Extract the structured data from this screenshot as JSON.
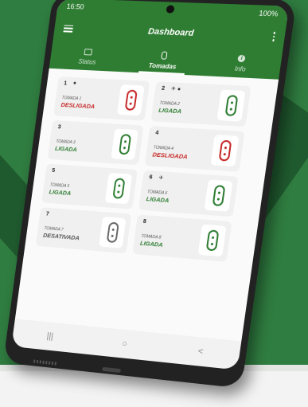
{
  "status_bar": {
    "time": "16:50",
    "battery": "100%"
  },
  "appbar": {
    "title": "Dashboard"
  },
  "tabs": [
    {
      "label": "Status"
    },
    {
      "label": "Tomadas"
    },
    {
      "label": "Info"
    }
  ],
  "info_glyph": "i",
  "cards": [
    {
      "number": "1",
      "extra": "●",
      "name": "TOMADA 1",
      "state": "DESLIGADA",
      "status": "off"
    },
    {
      "number": "2",
      "extra": "✈ ●",
      "name": "TOMADA 2",
      "state": "LIGADA",
      "status": "on"
    },
    {
      "number": "3",
      "extra": "",
      "name": "TOMADA 3",
      "state": "LIGADA",
      "status": "on"
    },
    {
      "number": "4",
      "extra": "",
      "name": "TOMADA 4",
      "state": "DESLIGADA",
      "status": "off"
    },
    {
      "number": "5",
      "extra": "",
      "name": "TOMADA 5",
      "state": "LIGADA",
      "status": "on"
    },
    {
      "number": "6",
      "extra": "✈",
      "name": "TOMADA 6",
      "state": "LIGADA",
      "status": "on"
    },
    {
      "number": "7",
      "extra": "",
      "name": "TOMADA 7",
      "state": "DESATIVADA",
      "status": "disabled"
    },
    {
      "number": "8",
      "extra": "",
      "name": "TOMADA 8",
      "state": "LIGADA",
      "status": "on"
    }
  ],
  "navbar": {
    "recent": "|||",
    "home": "○",
    "back": "<"
  },
  "colors": {
    "primary": "#2e7d32",
    "off": "#c62828",
    "disabled": "#666666"
  }
}
